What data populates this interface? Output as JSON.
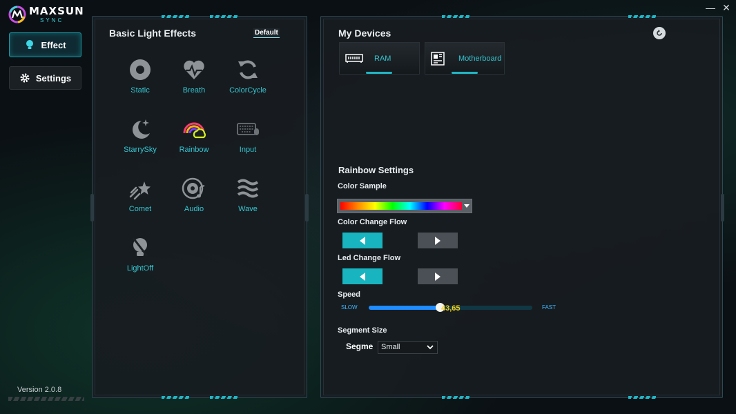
{
  "app": {
    "logo_name": "MAXSUN",
    "logo_sub": "SYNC",
    "version": "Version 2.0.8",
    "accent": "#1fb7c7"
  },
  "window": {
    "minimize_glyph": "—",
    "close_glyph": "✕"
  },
  "nav": {
    "effect_label": "Effect",
    "settings_label": "Settings",
    "active": "Effect"
  },
  "effects_panel": {
    "title": "Basic Light Effects",
    "default_label": "Default",
    "items": [
      {
        "label": "Static",
        "icon": "static-icon"
      },
      {
        "label": "Breath",
        "icon": "breath-icon"
      },
      {
        "label": "ColorCycle",
        "icon": "colorcycle-icon"
      },
      {
        "label": "StarrySky",
        "icon": "starrysky-icon"
      },
      {
        "label": "Rainbow",
        "icon": "rainbow-icon"
      },
      {
        "label": "Input",
        "icon": "keyboard-icon"
      },
      {
        "label": "Comet",
        "icon": "comet-icon"
      },
      {
        "label": "Audio",
        "icon": "audio-icon"
      },
      {
        "label": "Wave",
        "icon": "wave-icon"
      },
      {
        "label": "LightOff",
        "icon": "lightoff-icon"
      }
    ],
    "selected": "Rainbow"
  },
  "devices_panel": {
    "title": "My Devices",
    "devices": [
      {
        "label": "RAM",
        "icon": "ram-icon"
      },
      {
        "label": "Motherboard",
        "icon": "motherboard-icon"
      }
    ]
  },
  "settings": {
    "title": "Rainbow Settings",
    "color_sample_label": "Color Sample",
    "color_change_flow_label": "Color Change Flow",
    "led_change_flow_label": "Led Change Flow",
    "color_change_flow": "left",
    "led_change_flow": "left",
    "speed_label": "Speed",
    "speed_slow": "SLOW",
    "speed_fast": "FAST",
    "speed_value": "43,65",
    "speed_fraction": 0.4365,
    "segment_size_label": "Segment Size",
    "segment_field_label": "Segme",
    "segment_value": "Small"
  }
}
